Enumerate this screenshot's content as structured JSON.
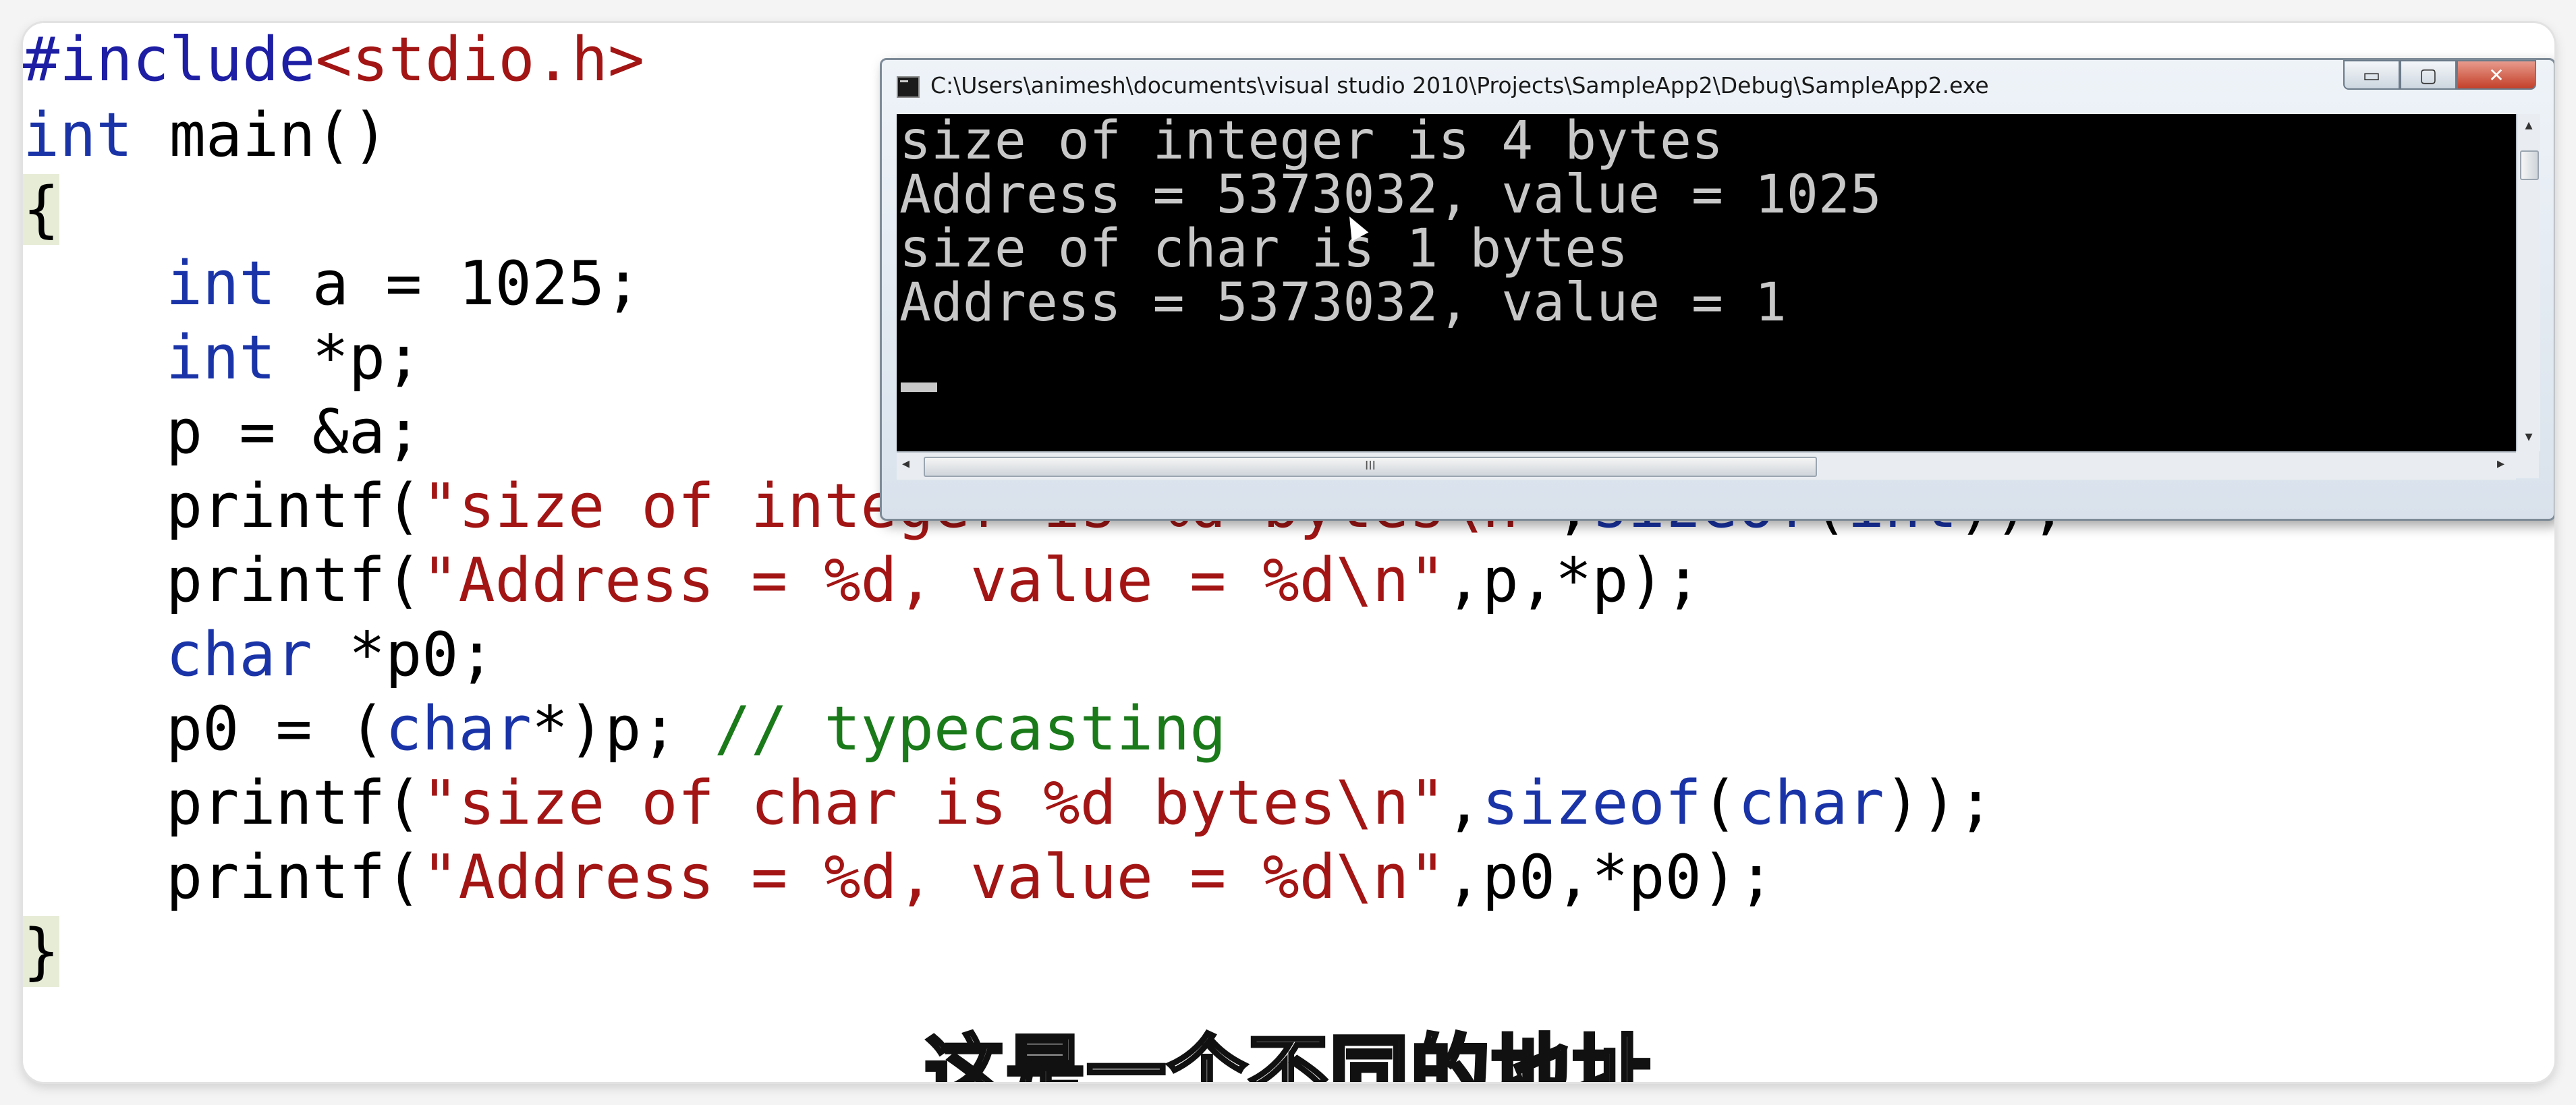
{
  "code": {
    "l1_directive": "#include",
    "l1_header": "<stdio.h>",
    "l2_kw": "int",
    "l2_rest": " main()",
    "l3": "{",
    "l4_kw": "int",
    "l4_rest": " a = 1025;",
    "l5_kw": "int",
    "l5_rest": " *p;",
    "l6": "p = &a;",
    "l7_a": "printf(",
    "l7_str": "\"size of integer is %d bytes\\n\"",
    "l7_b": ",",
    "l7_kw1": "sizeof",
    "l7_c": "(",
    "l7_kw2": "int",
    "l7_d": "));",
    "l8_a": "printf(",
    "l8_str": "\"Address = %d, value = %d\\n\"",
    "l8_b": ",p,*p);",
    "l9_kw": "char",
    "l9_rest": " *p0;",
    "l10_a": "p0 = (",
    "l10_kw": "char",
    "l10_b": "*)p; ",
    "l10_comment": "// typecasting",
    "l11_a": "printf(",
    "l11_str": "\"size of char is %d bytes\\n\"",
    "l11_b": ",",
    "l11_kw1": "sizeof",
    "l11_c": "(",
    "l11_kw2": "char",
    "l11_d": "));",
    "l12_a": "printf(",
    "l12_str": "\"Address = %d, value = %d\\n\"",
    "l12_b": ",p0,*p0);",
    "l13": "}"
  },
  "console": {
    "title": "C:\\Users\\animesh\\documents\\visual studio 2010\\Projects\\SampleApp2\\Debug\\SampleApp2.exe",
    "lines": [
      "size of integer is 4 bytes",
      "Address = 5373032, value = 1025",
      "size of char is 1 bytes",
      "Address = 5373032, value = 1"
    ],
    "min_symbol": "▭",
    "max_symbol": "▢",
    "close_symbol": "✕",
    "scroll_up": "▴",
    "scroll_down": "▾",
    "scroll_left": "◂",
    "scroll_right": "▸",
    "thumb_grip": "III"
  },
  "subtitle": "这是一个不同的地址",
  "icons": [
    "console-app-icon",
    "minimize-icon",
    "maximize-icon",
    "close-icon",
    "mouse-cursor-icon"
  ],
  "colors": {
    "keyword": "#1a34a8",
    "string": "#a31515",
    "comment": "#1a7a1a",
    "console_bg": "#000000",
    "console_text": "#c8c8c8"
  }
}
